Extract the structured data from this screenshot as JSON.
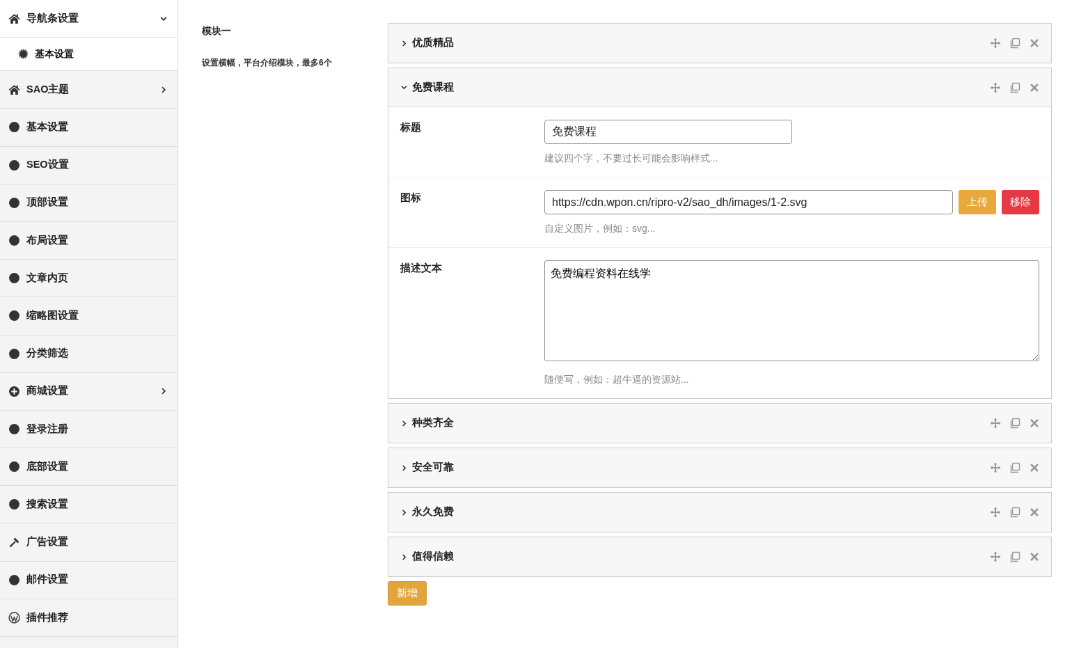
{
  "sidebar": {
    "items": [
      {
        "label": "导航条设置",
        "expanded": true,
        "children": [
          {
            "label": "基本设置",
            "selected": true
          }
        ]
      },
      {
        "label": "SAO主题",
        "expanded": false
      },
      {
        "label": "基本设置"
      },
      {
        "label": "SEO设置"
      },
      {
        "label": "顶部设置"
      },
      {
        "label": "布局设置"
      },
      {
        "label": "文章内页"
      },
      {
        "label": "缩略图设置"
      },
      {
        "label": "分类筛选"
      },
      {
        "label": "商城设置",
        "expanded": false
      },
      {
        "label": "登录注册"
      },
      {
        "label": "底部设置"
      },
      {
        "label": "搜索设置"
      },
      {
        "label": "广告设置"
      },
      {
        "label": "邮件设置"
      },
      {
        "label": "插件推荐"
      }
    ]
  },
  "section": {
    "title": "模块一",
    "description": "设置横幅，平台介绍模块，最多6个"
  },
  "panels": [
    {
      "title": "优质精品",
      "expanded": false
    },
    {
      "title": "免费课程",
      "expanded": true,
      "fields": [
        {
          "kind": "text",
          "label": "标题",
          "value": "免费课程",
          "help": "建议四个字，不要过长可能会影响样式..."
        },
        {
          "kind": "upload",
          "label": "图标",
          "value": "https://cdn.wpon.cn/ripro-v2/sao_dh/images/1-2.svg",
          "buttons": [
            "上传",
            "移除"
          ],
          "help": "自定义图片，例如：svg..."
        },
        {
          "kind": "textarea",
          "label": "描述文本",
          "value": "免费编程资料在线学",
          "help": "随便写，例如：超牛逼的资源站..."
        }
      ]
    },
    {
      "title": "种类齐全",
      "expanded": false
    },
    {
      "title": "安全可靠",
      "expanded": false
    },
    {
      "title": "永久免费",
      "expanded": false
    },
    {
      "title": "值得信赖",
      "expanded": false
    }
  ],
  "add_button": "新增"
}
